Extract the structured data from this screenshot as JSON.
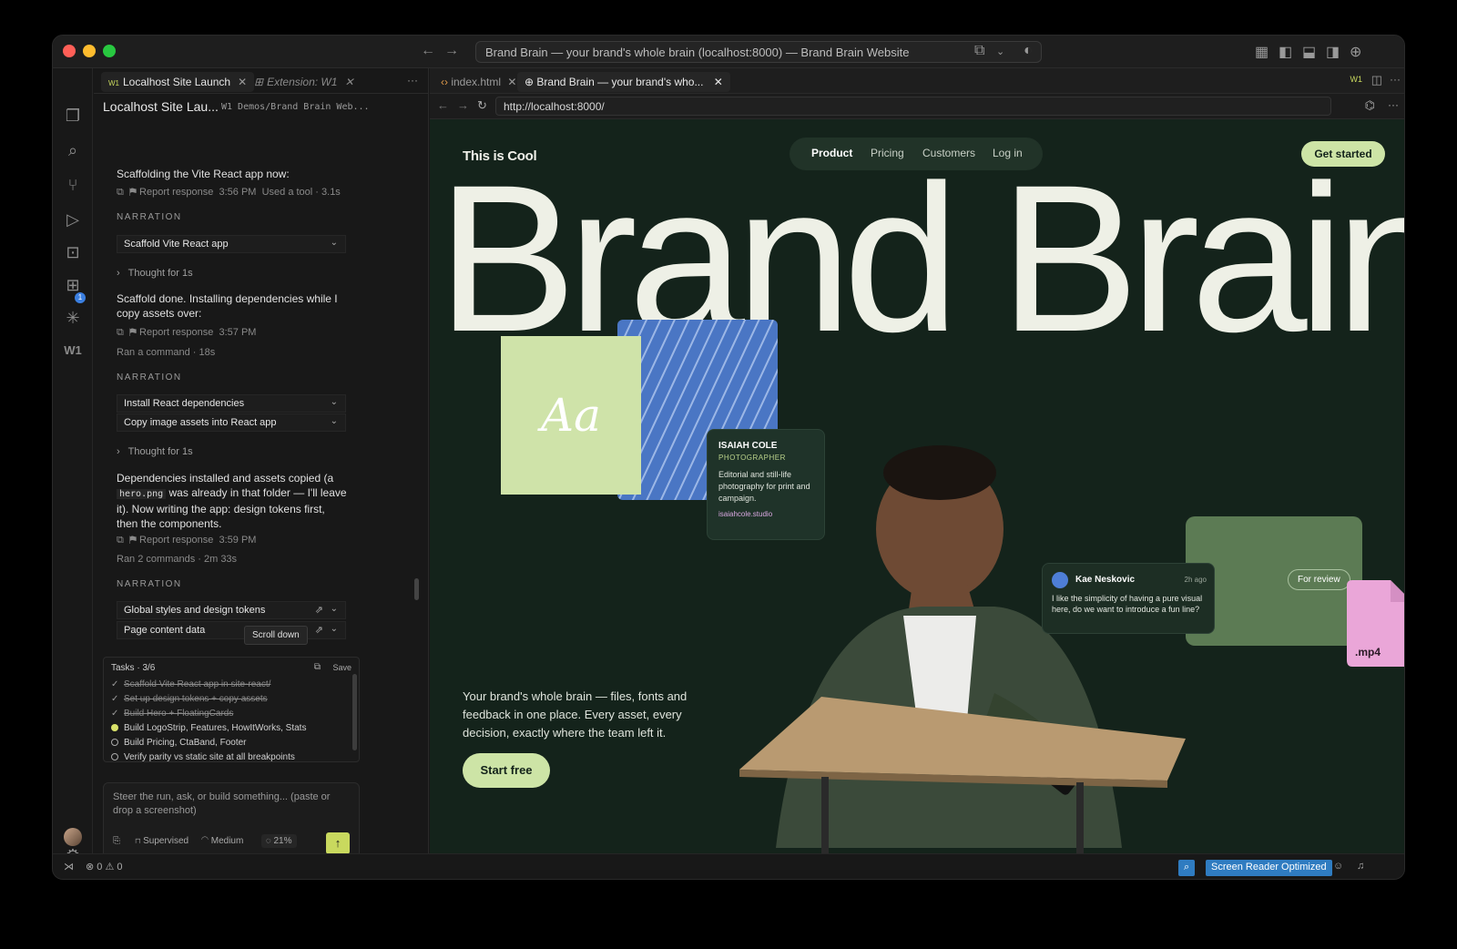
{
  "window": {
    "title": "Brand Brain — your brand's whole brain (localhost:8000) — Brand Brain Website"
  },
  "activity_bar": {
    "items": [
      "files-icon",
      "search-icon",
      "source-control-icon",
      "run-debug-icon",
      "remote-icon",
      "extensions-icon",
      "sparkle-icon"
    ],
    "w1_label": "W1",
    "extensions_badge": "1"
  },
  "panel": {
    "tabs": [
      {
        "badge": "W1",
        "label": "Localhost Site Launch"
      },
      {
        "label": "Extension: W1"
      }
    ],
    "title": "Localhost Site Lau...",
    "path": "W1 Demos/Brand Brain Web...",
    "msg1": "Scaffolding the Vite React app now:",
    "report": "Report response",
    "meta1_time": "3:56 PM",
    "meta1_extra": "Used a tool · 3.1s",
    "narration_label": "NARRATION",
    "acc1": "Scaffold Vite React app",
    "thought": "Thought for 1s",
    "msg2": "Scaffold done. Installing dependencies while I copy assets over:",
    "meta2_time": "3:57 PM",
    "ran1": "Ran a command · 18s",
    "acc2": "Install React dependencies",
    "acc3": "Copy image assets into React app",
    "msg3_a": "Dependencies installed and assets copied (a",
    "msg3_code": "hero.png",
    "msg3_b": "was already in that folder — I'll leave it). Now writing the app: design tokens first, then the components.",
    "meta3_time": "3:59 PM",
    "ran2": "Ran 2 commands · 2m 33s",
    "acc4": "Global styles and design tokens",
    "acc5": "Page content data",
    "tooltip": "Scroll down",
    "tasks": {
      "title": "Tasks · 3/6",
      "save": "Save",
      "items": [
        {
          "text": "Scaffold Vite React app in site-react/",
          "status": "done"
        },
        {
          "text": "Set up design tokens + copy assets",
          "status": "done"
        },
        {
          "text": "Build Hero + FloatingCards",
          "status": "done"
        },
        {
          "text": "Build LogoStrip, Features, HowItWorks, Stats",
          "status": "in-progress"
        },
        {
          "text": "Build Pricing, CtaBand, Footer",
          "status": "todo"
        },
        {
          "text": "Verify parity vs static site at all breakpoints",
          "status": "todo"
        }
      ]
    },
    "composer": {
      "placeholder": "Steer the run, ask, or build something... (paste or drop a screenshot)",
      "mode": "Supervised",
      "effort": "Medium",
      "progress": "21%"
    }
  },
  "editor": {
    "tabs": [
      {
        "label": "index.html"
      },
      {
        "label": "Brand Brain — your brand's who..."
      }
    ],
    "url": "http://localhost:8000/"
  },
  "site": {
    "logo": "This is Cool",
    "nav": [
      "Product",
      "Pricing",
      "Customers",
      "Log in"
    ],
    "cta": "Get started",
    "hero_title": "Brand Brain",
    "aa_card": "Aa",
    "profile": {
      "name": "ISAIAH COLE",
      "role": "PHOTOGRAPHER",
      "desc": "Editorial and still-life photography for print and campaign.",
      "link": "isaiahcole.studio"
    },
    "comment": {
      "name": "Kae Neskovic",
      "time": "2h ago",
      "body": "I like the simplicity of having a pure visual here, do we want to introduce a fun line?"
    },
    "review_label": "For review",
    "file_label": ".mp4",
    "tagline": "Your brand's whole brain — files, fonts and feedback in one place. Every asset, every decision, exactly where the team left it.",
    "start": "Start free",
    "colors": {
      "bg": "#14231b",
      "accent": "#cde4a6",
      "green_card": "#5c7b54",
      "pink": "#eaa6d8",
      "blue": "#4a76c4"
    }
  },
  "statusbar": {
    "errors": "0",
    "warnings": "0",
    "screen_reader": "Screen Reader Optimized"
  }
}
